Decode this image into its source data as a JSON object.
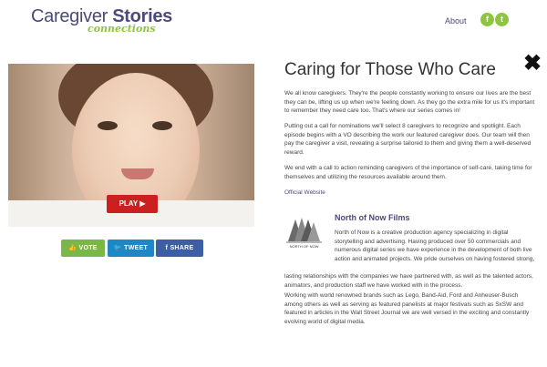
{
  "brand": {
    "logo_line1": "Caregiver",
    "logo_line1_bold": "Stories",
    "logo_sub": "connections",
    "color_primary": "#4b4a7a",
    "color_accent": "#8cc63f"
  },
  "nav": {
    "about": "About",
    "social": [
      {
        "icon": "facebook-icon",
        "glyph": "f"
      },
      {
        "icon": "twitter-icon",
        "glyph": "t"
      }
    ]
  },
  "close": {
    "icon": "close-icon",
    "glyph": "✖"
  },
  "media": {
    "play_label": "PLAY ▶"
  },
  "actions": {
    "vote": "VOTE",
    "tweet": "TWEET",
    "share": "SHARE",
    "vote_glyph": "👍",
    "tweet_glyph": "🐦",
    "share_glyph": "f"
  },
  "article": {
    "title": "Caring for Those Who Care",
    "p1": "We all know caregivers. They're the people constantly working to ensure our lives are the best they can be, lifting us up when we're feeling down. As they go the extra mile for us it's important to remember they need care too. That's where our series comes in!",
    "p2": "Putting out a call for nominations we'll select 8 caregivers to recognize and spotlight. Each episode begins with a VO describing the work our featured caregiver does. Our team will then pay the caregiver a visit, revealing a surprise tailored to them and giving them a well-deserved reward.",
    "p3": "We end with a call to action reminding caregivers of the importance of self-care, taking time for themselves and utilizing the resources available around them.",
    "website_link": "Official Website"
  },
  "company": {
    "name": "North of Now Films",
    "logo_text": "NORTH OF NOW",
    "p1": "North of Now is a creative production agency specializing in digital storytelling and advertising. Having produced over 50 commercials and numerous digital series we have experience in the development of both live action and animated projects. We pride ourselves on having fostered strong,",
    "p1b": "lasting relationships with the companies we have partnered with, as well as the talented actors, animators, and production staff we have worked with in the process.",
    "p2": "Working with world renowned brands such as Lego, Band-Aid, Ford and Anheuser-Busch among others as well as serving as featured panelists at major festivals such as SxSW and featured in articles in the Wall Street Journal we are well versed in the exciting and constantly evolving world of digital media."
  }
}
